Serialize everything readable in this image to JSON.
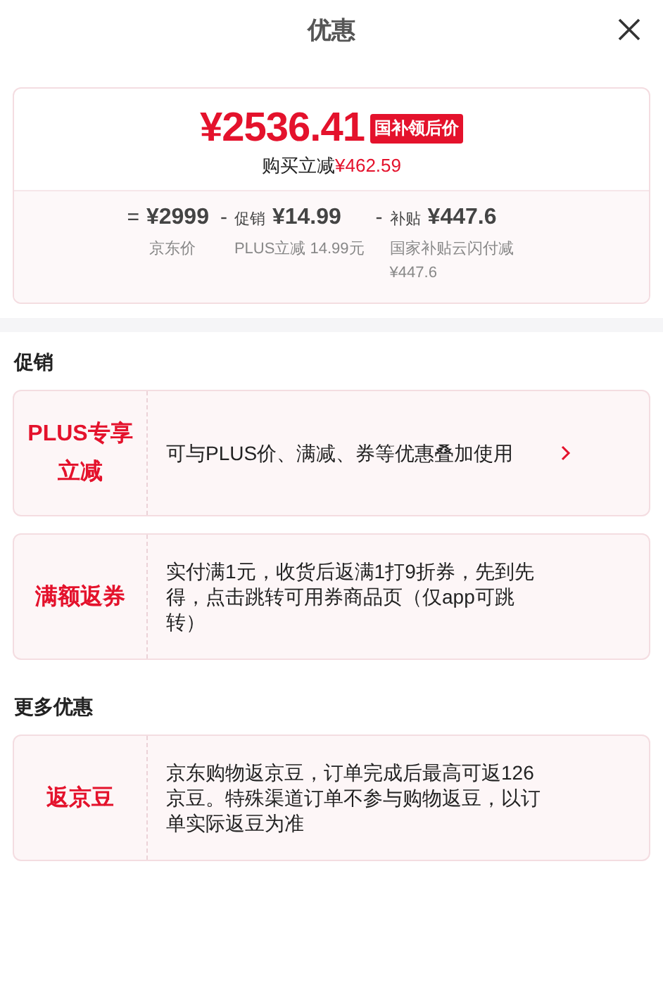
{
  "header": {
    "title": "优惠"
  },
  "summary": {
    "price": "¥2536.41",
    "badge": "国补领后价",
    "saving_label": "购买立减",
    "saving_amount": "¥462.59",
    "breakdown": [
      {
        "op": "=",
        "amount": "¥2999",
        "note": "京东价"
      },
      {
        "op": "-",
        "label": "促销",
        "amount": "¥14.99",
        "note": "PLUS立减 14.99元"
      },
      {
        "op": "-",
        "label": "补贴",
        "amount": "¥447.6",
        "note": "国家补贴云闪付减¥447.6"
      }
    ]
  },
  "sections": [
    {
      "title": "促销",
      "offers": [
        {
          "tag": "PLUS专享立减",
          "description": "可与PLUS价、满减、券等优惠叠加使用",
          "chevron": true
        },
        {
          "tag": "满额返券",
          "description": "实付满1元，收货后返满1打9折券，先到先得，点击跳转可用券商品页（仅app可跳转）",
          "chevron": false
        }
      ]
    },
    {
      "title": "更多优惠",
      "offers": [
        {
          "tag": "返京豆",
          "description": "京东购物返京豆，订单完成后最高可返126京豆。特殊渠道订单不参与购物返豆，以订单实际返豆为准",
          "chevron": false
        }
      ]
    }
  ]
}
